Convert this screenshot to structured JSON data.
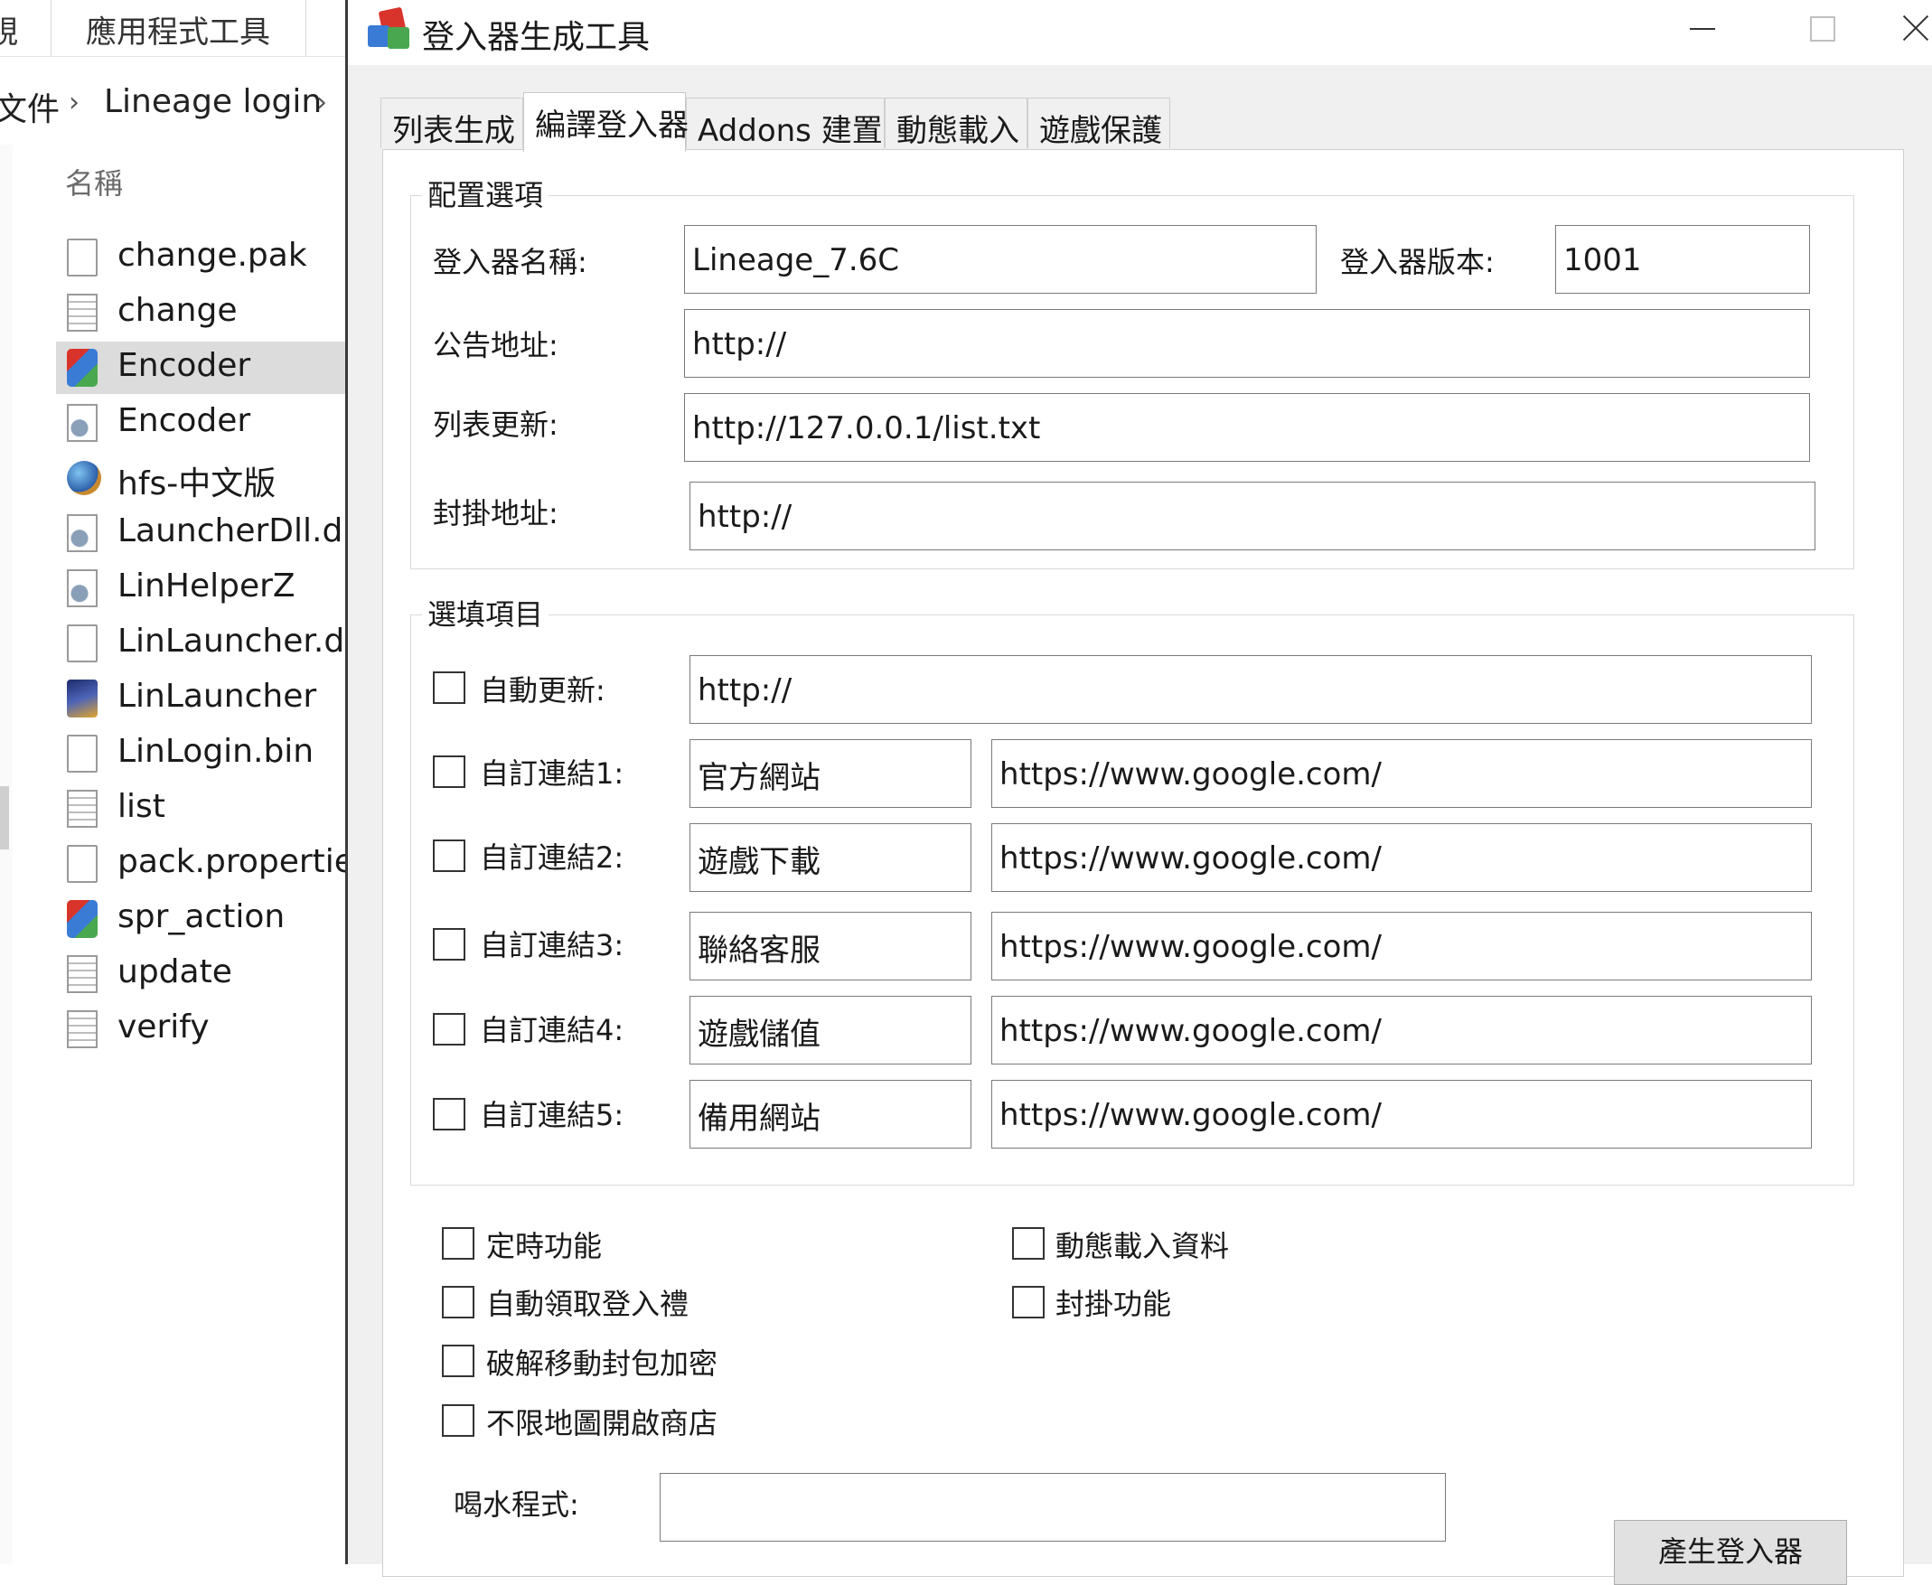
{
  "explorer": {
    "ribbon_tabs": [
      "視",
      "應用程式工具"
    ],
    "breadcrumb": [
      "文件",
      "Lineage login"
    ],
    "column_header": "名稱",
    "files": [
      {
        "name": "change.pak",
        "icon": "doc"
      },
      {
        "name": "change",
        "icon": "txt"
      },
      {
        "name": "Encoder",
        "icon": "app",
        "selected": true
      },
      {
        "name": "Encoder",
        "icon": "gear"
      },
      {
        "name": "hfs-中文版",
        "icon": "globe"
      },
      {
        "name": "LauncherDll.dll",
        "icon": "gear"
      },
      {
        "name": "LinHelperZ",
        "icon": "gear"
      },
      {
        "name": "LinLauncher.dat",
        "icon": "doc"
      },
      {
        "name": "LinLauncher",
        "icon": "game"
      },
      {
        "name": "LinLogin.bin",
        "icon": "doc"
      },
      {
        "name": "list",
        "icon": "txt"
      },
      {
        "name": "pack.properties",
        "icon": "doc"
      },
      {
        "name": "spr_action",
        "icon": "app"
      },
      {
        "name": "update",
        "icon": "txt"
      },
      {
        "name": "verify",
        "icon": "txt"
      }
    ]
  },
  "dialog": {
    "title": "登入器生成工具",
    "tabs": [
      "列表生成",
      "編譯登入器",
      "Addons 建置",
      "動態載入",
      "遊戲保護"
    ],
    "active_tab": "編譯登入器",
    "config": {
      "group_label": "配置選項",
      "name_label": "登入器名稱:",
      "name_value": "Lineage_7.6C",
      "version_label": "登入器版本:",
      "version_value": "1001",
      "notice_label": "公告地址:",
      "notice_value": "http://",
      "list_label": "列表更新:",
      "list_value": "http://127.0.0.1/list.txt",
      "ban_label": "封掛地址:",
      "ban_value": "http://"
    },
    "optional": {
      "group_label": "選填項目",
      "auto_update_label": "自動更新:",
      "auto_update_value": "http://",
      "links": [
        {
          "label": "自訂連結1:",
          "name": "官方網站",
          "url": "https://www.google.com/"
        },
        {
          "label": "自訂連結2:",
          "name": "遊戲下載",
          "url": "https://www.google.com/"
        },
        {
          "label": "自訂連結3:",
          "name": "聯絡客服",
          "url": "https://www.google.com/"
        },
        {
          "label": "自訂連結4:",
          "name": "遊戲儲值",
          "url": "https://www.google.com/"
        },
        {
          "label": "自訂連結5:",
          "name": "備用網站",
          "url": "https://www.google.com/"
        }
      ]
    },
    "features": [
      "定時功能",
      "自動領取登入禮",
      "破解移動封包加密",
      "不限地圖開啟商店",
      "動態載入資料",
      "封掛功能"
    ],
    "water_label": "喝水程式:",
    "water_value": "",
    "generate_button": "產生登入器"
  }
}
